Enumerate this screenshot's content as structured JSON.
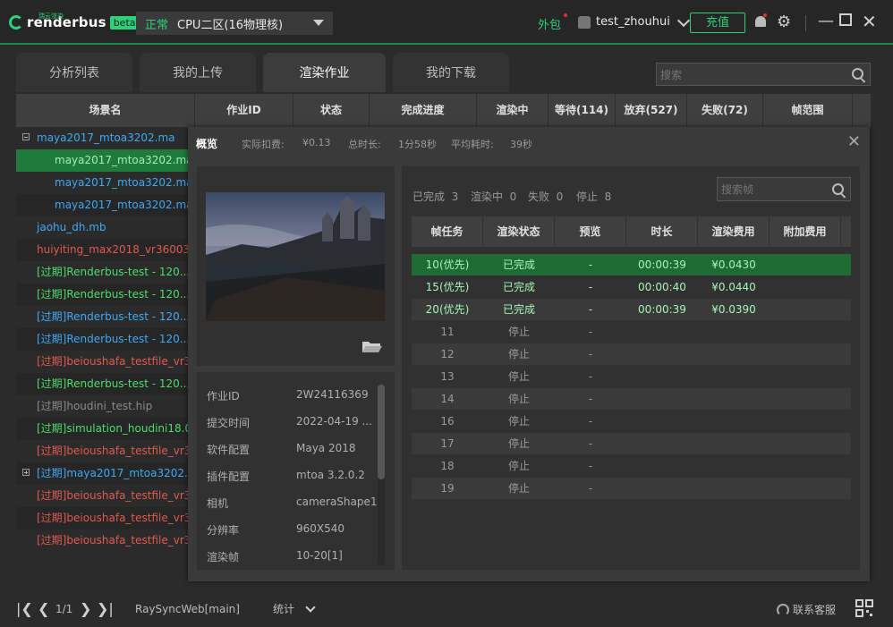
{
  "app": {
    "logo_small": "瑞云渲染",
    "logo_text": "renderbus",
    "logo_badge": "beta"
  },
  "header": {
    "mode": "正常",
    "zone": "CPU二区(16物理核)",
    "outsource": "外包",
    "username": "test_zhouhui",
    "recharge_label": "充值"
  },
  "tabs": [
    {
      "label": "分析列表",
      "active": false
    },
    {
      "label": "我的上传",
      "active": false
    },
    {
      "label": "渲染作业",
      "active": true
    },
    {
      "label": "我的下载",
      "active": false
    }
  ],
  "search": {
    "placeholder": "搜索"
  },
  "main_table": {
    "columns": [
      "场景名",
      "作业ID",
      "状态",
      "完成进度",
      "渲染中",
      "等待(114)",
      "放弃(527)",
      "失败(72)",
      "帧范围"
    ]
  },
  "jobs": [
    {
      "name": "maya2017_mtoa3202.ma",
      "color": "#3fa9f5",
      "indent": 0,
      "expander": "minus"
    },
    {
      "name": "maya2017_mtoa3202.ma...",
      "color": "#3fa9f5",
      "indent": 1,
      "selected": true
    },
    {
      "name": "maya2017_mtoa3202.ma...",
      "color": "#3fa9f5",
      "indent": 1
    },
    {
      "name": "maya2017_mtoa3202.ma...",
      "color": "#3fa9f5",
      "indent": 1
    },
    {
      "name": "jaohu_dh.mb",
      "color": "#3fa9f5",
      "indent": 0
    },
    {
      "name": "huiyiting_max2018_vr36003...",
      "color": "#e05a4f",
      "indent": 0
    },
    {
      "name": "[过期]Renderbus-test - 120....",
      "color": "#4fdc6a",
      "indent": 0
    },
    {
      "name": "[过期]Renderbus-test - 120....",
      "color": "#4fdc6a",
      "indent": 0
    },
    {
      "name": "[过期]Renderbus-test - 120....",
      "color": "#3fa9f5",
      "indent": 0
    },
    {
      "name": "[过期]Renderbus-test - 120....",
      "color": "#3fa9f5",
      "indent": 0
    },
    {
      "name": "[过期]beioushafa_testfile_vr3...",
      "color": "#e05a4f",
      "indent": 0
    },
    {
      "name": "[过期]Renderbus-test - 120....",
      "color": "#4fdc6a",
      "indent": 0
    },
    {
      "name": "[过期]houdini_test.hip",
      "color": "#8a8a8a",
      "indent": 0
    },
    {
      "name": "[过期]simulation_houdini18.0...",
      "color": "#4fdc6a",
      "indent": 0
    },
    {
      "name": "[过期]beioushafa_testfile_vr3...",
      "color": "#e05a4f",
      "indent": 0
    },
    {
      "name": "[过期]maya2017_mtoa3202...",
      "color": "#3fa9f5",
      "indent": 0,
      "expander": "plus"
    },
    {
      "name": "[过期]beioushafa_testfile_vr3...",
      "color": "#e05a4f",
      "indent": 0
    },
    {
      "name": "[过期]beioushafa_testfile_vr3...",
      "color": "#e05a4f",
      "indent": 0
    },
    {
      "name": "[过期]beioushafa_testfile_vr3...",
      "color": "#e05a4f",
      "indent": 0
    }
  ],
  "overview": {
    "title": "概览",
    "cost_label": "实际扣费:",
    "cost_value": "¥0.13",
    "total_label": "总时长:",
    "total_value": "1分58秒",
    "avg_label": "平均耗时:",
    "avg_value": "39秒",
    "info": [
      {
        "key": "作业ID",
        "value": "2W24116369"
      },
      {
        "key": "提交时间",
        "value": "2022-04-19 ..."
      },
      {
        "key": "软件配置",
        "value": "Maya 2018"
      },
      {
        "key": "插件配置",
        "value": "mtoa 3.2.0.2"
      },
      {
        "key": "相机",
        "value": "cameraShape1"
      },
      {
        "key": "分辨率",
        "value": "960X540"
      },
      {
        "key": "渲染帧",
        "value": "10-20[1]"
      }
    ],
    "frame_stats": [
      {
        "label": "已完成",
        "count": "3"
      },
      {
        "label": "渲染中",
        "count": "0"
      },
      {
        "label": "失败",
        "count": "0"
      },
      {
        "label": "停止",
        "count": "8"
      }
    ],
    "frame_search_placeholder": "搜索帧",
    "frame_columns": [
      "帧任务",
      "渲染状态",
      "预览",
      "时长",
      "渲染费用",
      "附加费用"
    ],
    "frames": [
      {
        "frame": "10(优先)",
        "status": "已完成",
        "preview": "-",
        "duration": "00:00:39",
        "cost": "¥0.0430",
        "done": true
      },
      {
        "frame": "15(优先)",
        "status": "已完成",
        "preview": "-",
        "duration": "00:00:40",
        "cost": "¥0.0440",
        "done": true
      },
      {
        "frame": "20(优先)",
        "status": "已完成",
        "preview": "-",
        "duration": "00:00:39",
        "cost": "¥0.0390",
        "done": true
      },
      {
        "frame": "11",
        "status": "停止",
        "preview": "-",
        "duration": "",
        "cost": "",
        "done": false
      },
      {
        "frame": "12",
        "status": "停止",
        "preview": "-",
        "duration": "",
        "cost": "",
        "done": false
      },
      {
        "frame": "13",
        "status": "停止",
        "preview": "-",
        "duration": "",
        "cost": "",
        "done": false
      },
      {
        "frame": "14",
        "status": "停止",
        "preview": "-",
        "duration": "",
        "cost": "",
        "done": false
      },
      {
        "frame": "16",
        "status": "停止",
        "preview": "-",
        "duration": "",
        "cost": "",
        "done": false
      },
      {
        "frame": "17",
        "status": "停止",
        "preview": "-",
        "duration": "",
        "cost": "",
        "done": false
      },
      {
        "frame": "18",
        "status": "停止",
        "preview": "-",
        "duration": "",
        "cost": "",
        "done": false
      },
      {
        "frame": "19",
        "status": "停止",
        "preview": "-",
        "duration": "",
        "cost": "",
        "done": false
      }
    ]
  },
  "bottom": {
    "page": "1/1",
    "server": "RaySyncWeb[main]",
    "stats_label": "统计",
    "support_label": "联系客服"
  },
  "colors": {
    "accent": "#2bd27a",
    "selected_row": "#1f7a3c",
    "blue": "#3fa9f5",
    "red": "#e05a4f",
    "green": "#4fdc6a"
  }
}
